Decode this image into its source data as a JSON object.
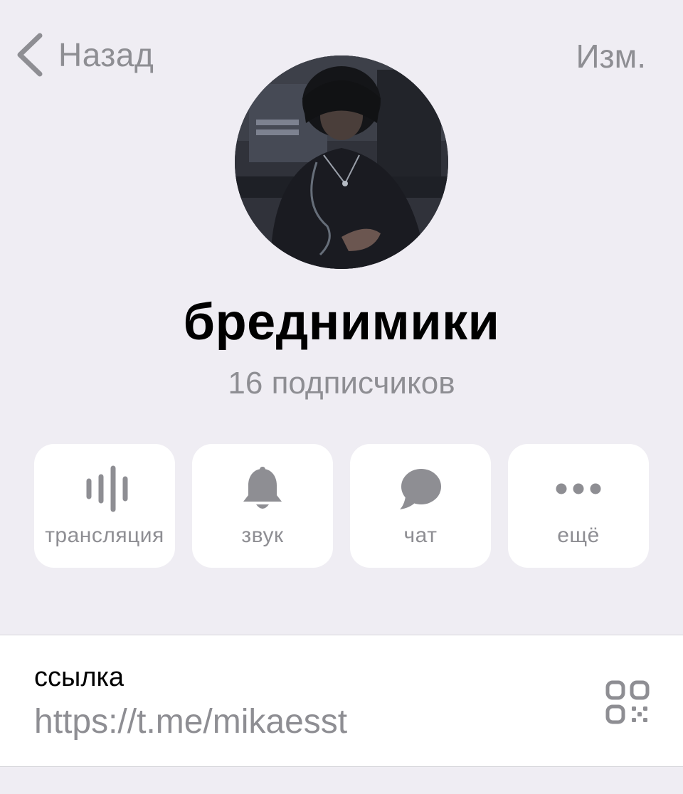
{
  "nav": {
    "back_label": "Назад",
    "edit_label": "Изм."
  },
  "channel": {
    "name": "бреднимики",
    "subscribers": "16 подписчиков"
  },
  "actions": [
    {
      "icon": "waveform-icon",
      "label": "трансляция"
    },
    {
      "icon": "bell-icon",
      "label": "звук"
    },
    {
      "icon": "chat-bubble-icon",
      "label": "чат"
    },
    {
      "icon": "more-dots-icon",
      "label": "ещё"
    }
  ],
  "link": {
    "caption": "ссылка",
    "url": "https://t.me/mikaesst",
    "icon": "qr-code-icon"
  },
  "colors": {
    "background": "#efedf3",
    "secondary_text": "#8e8e93",
    "card": "#ffffff"
  }
}
